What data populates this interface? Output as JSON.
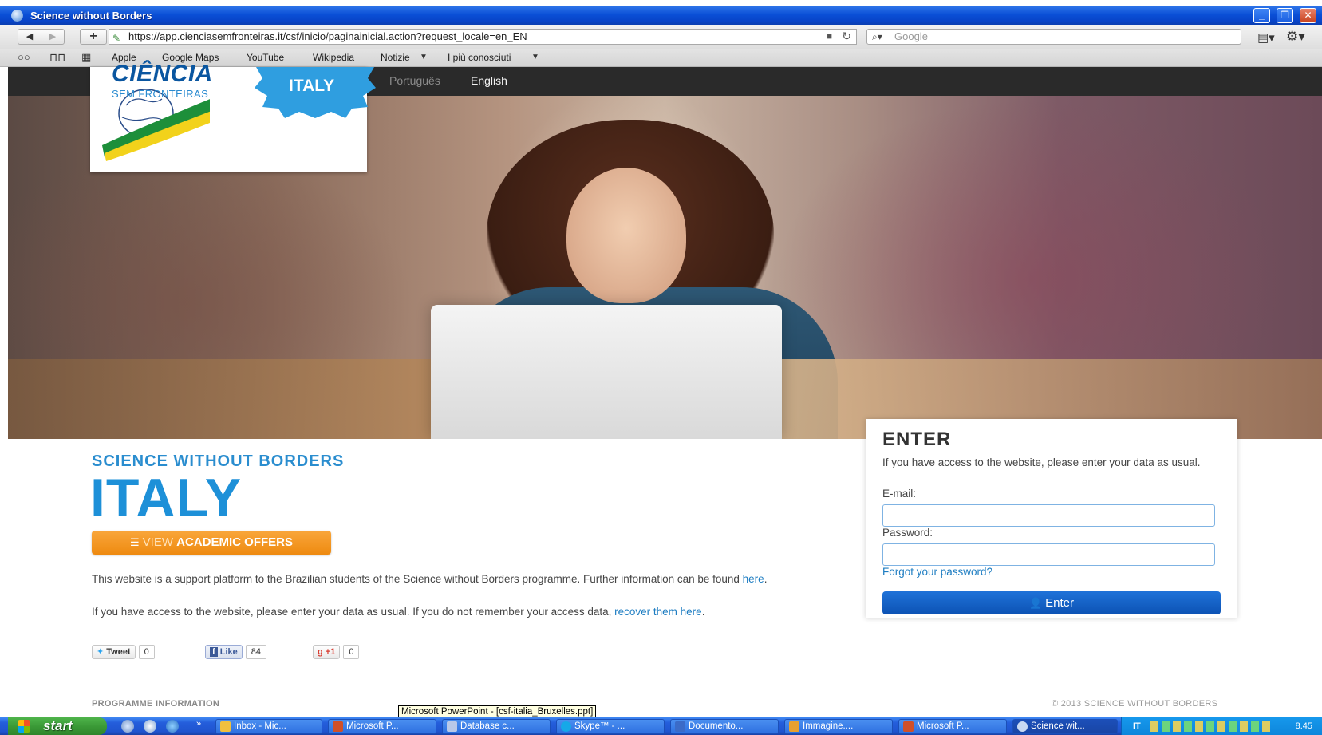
{
  "window": {
    "title": "Science without Borders"
  },
  "browser": {
    "url": "https://app.cienciasemfronteiras.it/csf/inicio/paginainicial.action?request_locale=en_EN",
    "search_placeholder": "Google",
    "bookmarks": [
      "Apple",
      "Google Maps",
      "YouTube",
      "Wikipedia",
      "Notizie",
      "I più conosciuti"
    ]
  },
  "site_nav": {
    "lang_pt": "Português",
    "lang_en": "English"
  },
  "logo": {
    "badge": "ITALY",
    "main": "CIÊNCIA",
    "sub": "SEM FRONTEIRAS"
  },
  "main": {
    "kicker": "SCIENCE WITHOUT BORDERS",
    "title": "ITALY",
    "offers_button": {
      "pre": "VIEW",
      "strong": "ACADEMIC OFFERS"
    },
    "para1": {
      "text": "This website is a support platform to the Brazilian students of the Science without Borders programme. Further information can be found ",
      "link": "here",
      "end": "."
    },
    "para2": {
      "text": "If you have access to the website, please enter your data as usual. If you do not remember your access data, ",
      "link": "recover them here",
      "end": "."
    },
    "social": {
      "tweet_label": "Tweet",
      "tweet_count": "0",
      "like_label": "Like",
      "like_count": "84",
      "plus_label": "+1",
      "plus_count": "0"
    }
  },
  "login": {
    "title": "ENTER",
    "intro": "If you have access to the website, please enter your data as usual.",
    "email_label": "E-mail:",
    "password_label": "Password:",
    "forgot": "Forgot your password?",
    "enter_button": "Enter"
  },
  "footer": {
    "left": "PROGRAMME INFORMATION",
    "right": "© 2013 SCIENCE WITHOUT BORDERS",
    "tooltip": "Microsoft PowerPoint - [csf-italia_Bruxelles.ppt]"
  },
  "taskbar": {
    "start": "start",
    "tasks": [
      "Inbox - Mic...",
      "Microsoft P...",
      "Database c...",
      "Skype™ - ...",
      "Documento...",
      "Immagine....",
      "Microsoft P...",
      "Science wit..."
    ],
    "tray_lang": "IT",
    "clock": "8.45"
  }
}
